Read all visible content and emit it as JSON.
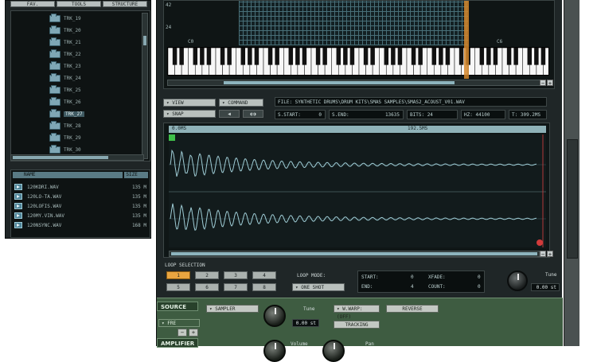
{
  "browser": {
    "tabs": [
      "FAV.",
      "TOOLS",
      "STRUCTURE"
    ],
    "folders": [
      "TRK_19",
      "TRK_20",
      "TRK_21",
      "TRK_22",
      "TRK_23",
      "TRK_24",
      "TRK_25",
      "TRK_26",
      "TRK_27",
      "TRK_28",
      "TRK_29",
      "TRK_30"
    ],
    "selected_folder_index": 8,
    "file_headers": {
      "name": "NAME",
      "size": "SIZE"
    },
    "files": [
      {
        "name": "120KDRI.WAV",
        "size": "135 M"
      },
      {
        "name": "120LO-TA.WAV",
        "size": "135 M"
      },
      {
        "name": "120LOFIS.WAV",
        "size": "135 M"
      },
      {
        "name": "120MY.VIN.WAV",
        "size": "135 M"
      },
      {
        "name": "120NSYNC.WAV",
        "size": "168 M"
      }
    ]
  },
  "keyboard": {
    "row_labels": [
      "42",
      "24"
    ],
    "octave_labels": [
      "C0",
      "C6"
    ]
  },
  "toolbar": {
    "view": "▾ VIEW",
    "command": "▾ COMMAND",
    "snap": "▾ SNAP",
    "play_icon": "◀",
    "loop_icon": "◐◑"
  },
  "info": {
    "file": "FILE: SYNTHETIC DRUMS\\DRUM KITS\\SMAS SAMPLES\\SMAS2_ACOUST_V01.WAV",
    "s_start_label": "S.START:",
    "s_start": "0",
    "s_end_label": "S.END:",
    "s_end": "13635",
    "bits_label": "BITS:",
    "bits": "24",
    "hz_label": "HZ:",
    "hz": "44100",
    "t_label": "T:",
    "t": "309.2MS"
  },
  "waveform": {
    "ruler_start": "0.0MS",
    "ruler_mid": "192.5MS"
  },
  "loop": {
    "title": "LOOP SELECTION",
    "buttons": [
      "1",
      "2",
      "3",
      "4",
      "5",
      "6",
      "7",
      "8"
    ],
    "active_index": 0,
    "mode_label": "LOOP MODE:",
    "mode_value": "▾ ONE SHOT",
    "start_label": "START:",
    "start": "0",
    "end_label": "END:",
    "end": "4",
    "xfade_label": "XFADE:",
    "xfade": "0",
    "count_label": "COUNT:",
    "count": "0",
    "tune_label": "Tune",
    "tune_value": "0.00 st"
  },
  "source": {
    "header": "SOURCE",
    "fre_label": "▾ FRE",
    "minus": "−",
    "plus": "+",
    "sampler": "▾ SAMPLER",
    "tune_label": "Tune",
    "tune_value": "0.00 st",
    "warp": "▾ W.WARP: (OFF)",
    "reverse": "REVERSE",
    "tracking": "TRACKING"
  },
  "amplifier": {
    "header": "AMPLIFIER",
    "volume_label": "Volume",
    "pan_label": "Pan"
  },
  "colors": {
    "accent_orange": "#e9a540",
    "waveform": "#9fcdd6",
    "panel_green": "#3e5c41"
  }
}
